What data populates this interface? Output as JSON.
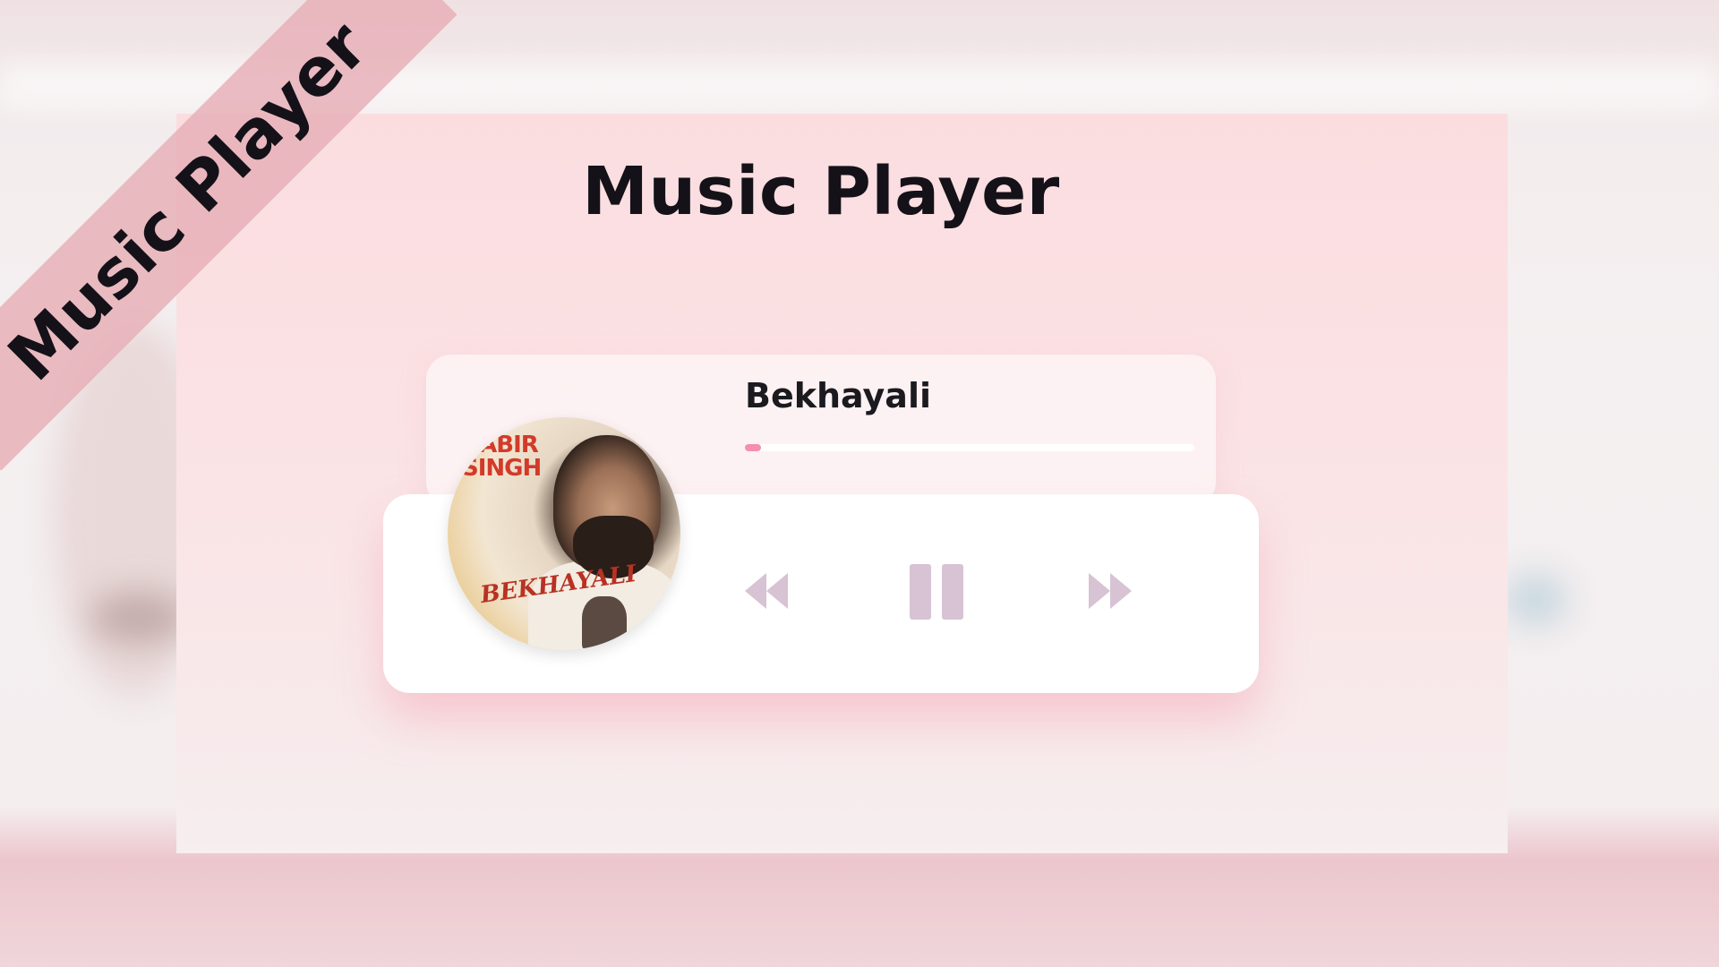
{
  "ribbon": {
    "label": "Music Player"
  },
  "header": {
    "title": "Music Player"
  },
  "player": {
    "song_title": "Bekhayali",
    "progress": 0.03,
    "album_art": {
      "text_top": "KABIR SINGH",
      "text_mid": "BEKHAYALI"
    },
    "controls": {
      "prev_icon": "rewind-icon",
      "play_icon": "pause-icon",
      "next_icon": "fast-forward-icon"
    }
  },
  "colors": {
    "accent": "#f48fb1",
    "control_icon": "#d7c3d3",
    "panel": "#fbdde0"
  }
}
